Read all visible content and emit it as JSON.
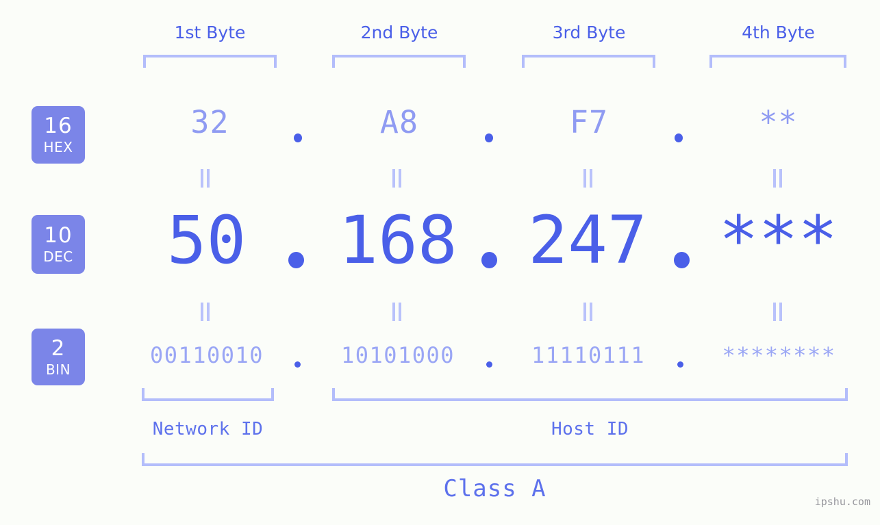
{
  "theme": {
    "background": "#fbfdf9",
    "accent_strong": "#4a5fe8",
    "accent_mid": "#8f9bf2",
    "accent_light": "#b3bdfb",
    "badge_bg": "#7b85e8",
    "badge_text": "#ffffff",
    "watermark_color": "#96969c"
  },
  "headers": [
    {
      "label": "1st Byte"
    },
    {
      "label": "2nd Byte"
    },
    {
      "label": "3rd Byte"
    },
    {
      "label": "4th Byte"
    }
  ],
  "bases": [
    {
      "number": "16",
      "name": "HEX"
    },
    {
      "number": "10",
      "name": "DEC"
    },
    {
      "number": "2",
      "name": "BIN"
    }
  ],
  "rows": {
    "hex": {
      "b1": "32",
      "b2": "A8",
      "b3": "F7",
      "b4": "**"
    },
    "dec": {
      "b1": "50",
      "b2": "168",
      "b3": "247",
      "b4": "***"
    },
    "bin": {
      "b1": "00110010",
      "b2": "10101000",
      "b3": "11110111",
      "b4": "********"
    }
  },
  "separators": {
    "dot": "."
  },
  "equality": {
    "symbol": "="
  },
  "segments": {
    "network_id": "Network ID",
    "host_id": "Host ID",
    "class": "Class A"
  },
  "watermark": "ipshu.com"
}
